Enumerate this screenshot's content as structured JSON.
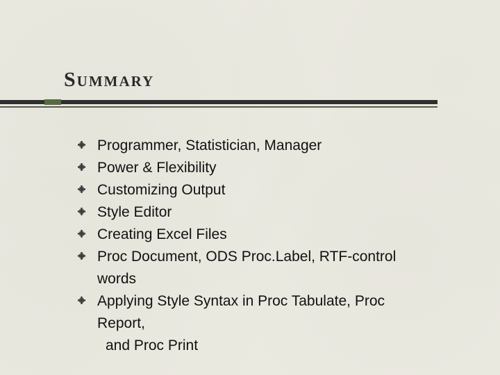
{
  "title": "Summary",
  "bullets": {
    "b0": "Programmer, Statistician, Manager",
    "b1": "Power & Flexibility",
    "b2": "Customizing Output",
    "b3": "Style Editor",
    "b4": "Creating Excel Files",
    "b5": "Proc Document, ODS Proc.Label, RTF-control",
    "b5_cont": "words",
    "b6": "Applying Style Syntax in Proc Tabulate, Proc",
    "b6_cont1": "Report,",
    "b6_cont2": " and Proc Print"
  }
}
